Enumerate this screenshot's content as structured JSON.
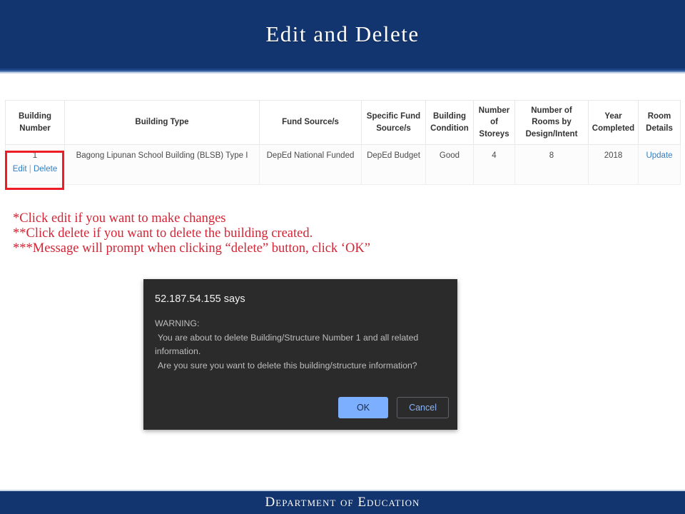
{
  "slide": {
    "title": "Edit and Delete",
    "footer": "Department of Education"
  },
  "table": {
    "headers": [
      "Building Number",
      "Building Type",
      "Fund Source/s",
      "Specific Fund Source/s",
      "Building Condition",
      "Number of Storeys",
      "Number of Rooms by Design/Intent",
      "Year Completed",
      "Room Details"
    ],
    "row": {
      "building_number": "1",
      "edit_label": "Edit",
      "separator": "|",
      "delete_label": "Delete",
      "building_type": "Bagong Lipunan School Building (BLSB) Type I",
      "fund_source": "DepEd National Funded",
      "specific_fund_source": "DepEd Budget",
      "building_condition": "Good",
      "number_of_storeys": "4",
      "number_of_rooms": "8",
      "year_completed": "2018",
      "room_details": "Update"
    },
    "highlight_color": "#ee1c25"
  },
  "notes": {
    "line1": "*Click edit if you want to make changes",
    "line2": "**Click delete if you want to delete the building created.",
    "line3": "***Message will prompt when clicking “delete” button, click ‘OK”",
    "color": "#d32535"
  },
  "dialog": {
    "title": "52.187.54.155 says",
    "body_line1": "WARNING:",
    "body_line2": "You are about to delete  Building/Structure Number 1 and all related",
    "body_line3": "information.",
    "body_line4": "Are you sure you want to delete this building/structure information?",
    "ok_label": "OK",
    "cancel_label": "Cancel",
    "background": "#2b2b2b",
    "ok_color": "#7cafff"
  },
  "theme": {
    "navy": "#123570",
    "link_blue": "#2f7ec4"
  }
}
